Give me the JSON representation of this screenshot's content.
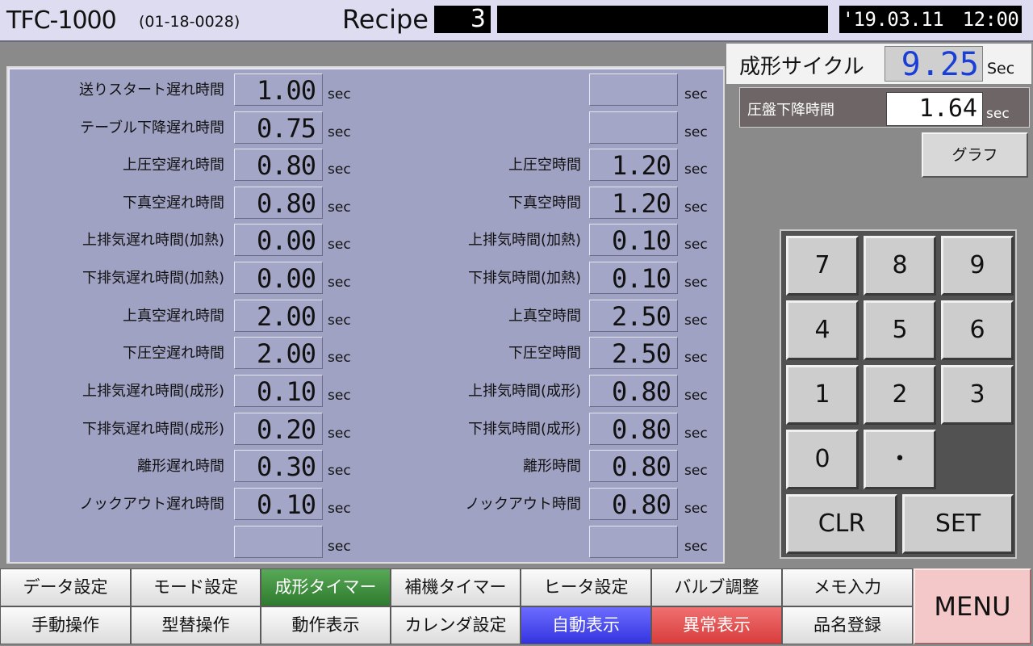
{
  "header": {
    "model": "TFC-1000",
    "serial": "(01-18-0028)",
    "recipe_label": "Recipe",
    "recipe_number": "3",
    "recipe_name": "",
    "datetime": "'19.03.11　12:00"
  },
  "unit": "sec",
  "left_rows": [
    {
      "label": "送りスタート遅れ時間",
      "value": "1.00"
    },
    {
      "label": "テーブル下降遅れ時間",
      "value": "0.75"
    },
    {
      "label": "上圧空遅れ時間",
      "value": "0.80"
    },
    {
      "label": "下真空遅れ時間",
      "value": "0.80"
    },
    {
      "label": "上排気遅れ時間(加熱)",
      "value": "0.00"
    },
    {
      "label": "下排気遅れ時間(加熱)",
      "value": "0.00"
    },
    {
      "label": "上真空遅れ時間",
      "value": "2.00"
    },
    {
      "label": "下圧空遅れ時間",
      "value": "2.00"
    },
    {
      "label": "上排気遅れ時間(成形)",
      "value": "0.10"
    },
    {
      "label": "下排気遅れ時間(成形)",
      "value": "0.20"
    },
    {
      "label": "離形遅れ時間",
      "value": "0.30"
    },
    {
      "label": "ノックアウト遅れ時間",
      "value": "0.10"
    },
    {
      "label": "",
      "value": ""
    }
  ],
  "right_rows": [
    {
      "label": "",
      "value": ""
    },
    {
      "label": "",
      "value": ""
    },
    {
      "label": "上圧空時間",
      "value": "1.20"
    },
    {
      "label": "下真空時間",
      "value": "1.20"
    },
    {
      "label": "上排気時間(加熱)",
      "value": "0.10"
    },
    {
      "label": "下排気時間(加熱)",
      "value": "0.10"
    },
    {
      "label": "上真空時間",
      "value": "2.50"
    },
    {
      "label": "下圧空時間",
      "value": "2.50"
    },
    {
      "label": "上排気時間(成形)",
      "value": "0.80"
    },
    {
      "label": "下排気時間(成形)",
      "value": "0.80"
    },
    {
      "label": "離形時間",
      "value": "0.80"
    },
    {
      "label": "ノックアウト時間",
      "value": "0.80"
    },
    {
      "label": "",
      "value": ""
    }
  ],
  "cycle": {
    "label": "成形サイクル",
    "value": "9.25",
    "unit": "Sec"
  },
  "press": {
    "label": "圧盤下降時間",
    "value": "1.64",
    "unit": "sec"
  },
  "graph_button": "グラフ",
  "keypad": {
    "k7": "7",
    "k8": "8",
    "k9": "9",
    "k4": "4",
    "k5": "5",
    "k6": "6",
    "k1": "1",
    "k2": "2",
    "k3": "3",
    "k0": "0",
    "kdot": "•",
    "clr": "CLR",
    "set": "SET"
  },
  "nav": {
    "row1": [
      "データ設定",
      "モード設定",
      "成形タイマー",
      "補機タイマー",
      "ヒータ設定",
      "バルブ調整",
      "メモ入力"
    ],
    "row2": [
      "手動操作",
      "型替操作",
      "動作表示",
      "カレンダ設定",
      "自動表示",
      "異常表示",
      "品名登録"
    ],
    "menu": "MENU"
  },
  "colors": {
    "active_tab": "#3f8f3f",
    "auto_display": "#4a4af0",
    "alarm_display": "#e04848",
    "cycle_value": "#1a3fd6"
  }
}
